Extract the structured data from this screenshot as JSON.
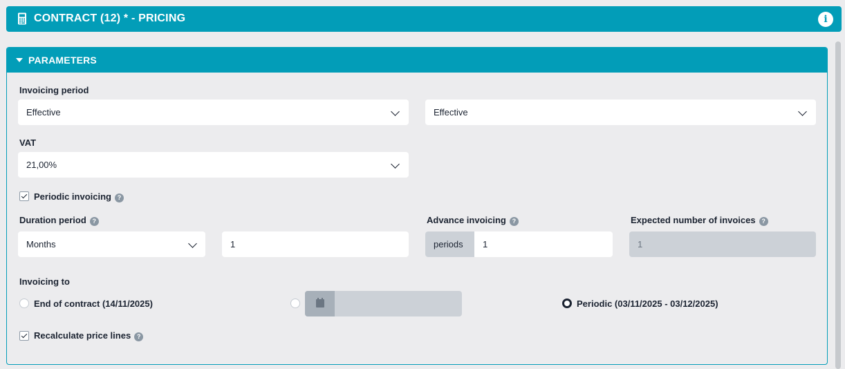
{
  "header": {
    "title": "CONTRACT (12) * - PRICING",
    "icon": "calculator-icon",
    "info_icon": "info-icon",
    "info_glyph": "i"
  },
  "parameters": {
    "title": "PARAMETERS",
    "invoicing_period": {
      "label": "Invoicing period",
      "select1": "Effective",
      "select2": "Effective"
    },
    "vat": {
      "label": "VAT",
      "value": "21,00%"
    },
    "periodic_invoicing": {
      "label": "Periodic invoicing",
      "checked": true
    },
    "duration_period": {
      "label": "Duration period",
      "unit": "Months",
      "value": "1"
    },
    "advance_invoicing": {
      "label": "Advance invoicing",
      "addon": "periods",
      "value": "1"
    },
    "expected_invoices": {
      "label": "Expected number of invoices",
      "value": "1"
    },
    "invoicing_to": {
      "label": "Invoicing to",
      "option_end": "End of contract (14/11/2025)",
      "option_periodic": "Periodic (03/11/2025 - 03/12/2025)",
      "selected": "periodic"
    },
    "recalculate": {
      "label": "Recalculate price lines",
      "checked": true
    },
    "help_glyph": "?"
  },
  "colors": {
    "accent": "#029db8",
    "text": "#1b2331",
    "disabled": "#ccd1d7"
  }
}
